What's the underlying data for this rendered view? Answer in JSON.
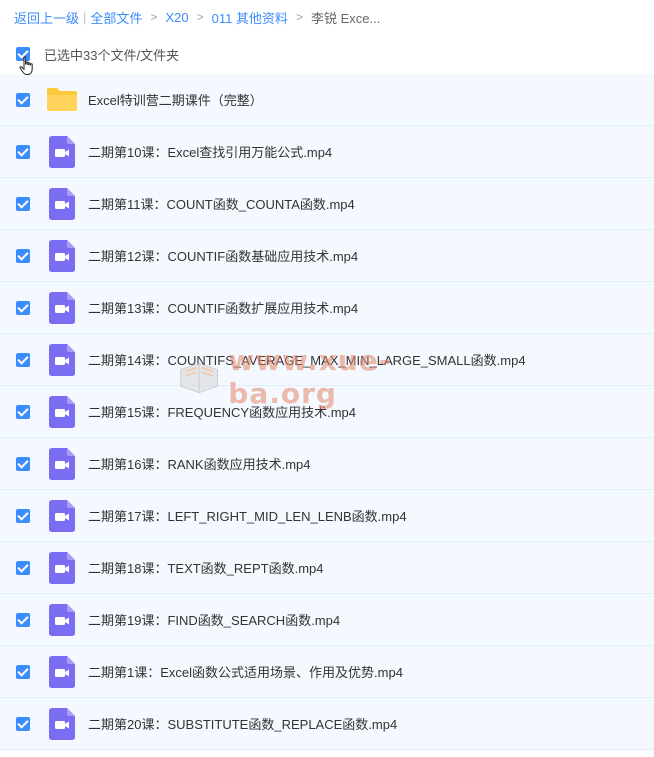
{
  "breadcrumb": {
    "back": "返回上一级",
    "all_files": "全部文件",
    "path": [
      "X20",
      "011 其他资料"
    ],
    "current": "李锐 Exce..."
  },
  "selection": {
    "label": "已选中33个文件/文件夹"
  },
  "files": [
    {
      "type": "folder",
      "name": "Excel特训营二期课件（完整）"
    },
    {
      "type": "video",
      "name": "二期第10课：Excel查找引用万能公式.mp4"
    },
    {
      "type": "video",
      "name": "二期第11课：COUNT函数_COUNTA函数.mp4"
    },
    {
      "type": "video",
      "name": "二期第12课：COUNTIF函数基础应用技术.mp4"
    },
    {
      "type": "video",
      "name": "二期第13课：COUNTIF函数扩展应用技术.mp4"
    },
    {
      "type": "video",
      "name": "二期第14课：COUNTIFS_AVERAGE_MAX_MIN_LARGE_SMALL函数.mp4"
    },
    {
      "type": "video",
      "name": "二期第15课：FREQUENCY函数应用技术.mp4"
    },
    {
      "type": "video",
      "name": "二期第16课：RANK函数应用技术.mp4"
    },
    {
      "type": "video",
      "name": "二期第17课：LEFT_RIGHT_MID_LEN_LENB函数.mp4"
    },
    {
      "type": "video",
      "name": "二期第18课：TEXT函数_REPT函数.mp4"
    },
    {
      "type": "video",
      "name": "二期第19课：FIND函数_SEARCH函数.mp4"
    },
    {
      "type": "video",
      "name": "二期第1课：Excel函数公式适用场景、作用及优势.mp4"
    },
    {
      "type": "video",
      "name": "二期第20课：SUBSTITUTE函数_REPLACE函数.mp4"
    }
  ],
  "watermark": "www.xue-ba.org",
  "colors": {
    "accent": "#3b8cff",
    "row_bg": "#f3f9fe",
    "folder": "#fcc93a",
    "video": "#7b6df2"
  }
}
